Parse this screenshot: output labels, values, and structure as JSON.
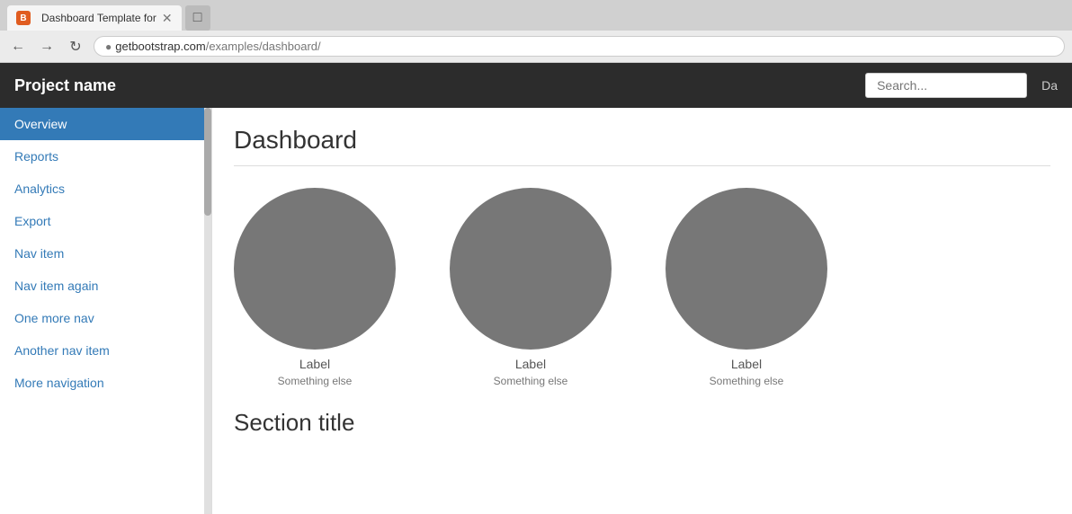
{
  "browser": {
    "tab_title": "Dashboard Template for",
    "tab_icon": "B",
    "address_domain": "getbootstrap.com",
    "address_path": "/examples/dashboard/",
    "new_tab_icon": "+"
  },
  "app": {
    "brand": "Project name",
    "search_placeholder": "Search...",
    "navbar_link": "Da"
  },
  "sidebar": {
    "items": [
      {
        "label": "Overview",
        "active": true
      },
      {
        "label": "Reports",
        "active": false
      },
      {
        "label": "Analytics",
        "active": false
      },
      {
        "label": "Export",
        "active": false
      },
      {
        "label": "Nav item",
        "active": false
      },
      {
        "label": "Nav item again",
        "active": false
      },
      {
        "label": "One more nav",
        "active": false
      },
      {
        "label": "Another nav item",
        "active": false
      },
      {
        "label": "More navigation",
        "active": false
      }
    ]
  },
  "main": {
    "page_title": "Dashboard",
    "section_title": "Section title",
    "charts": [
      {
        "label": "Label",
        "sublabel": "Something else"
      },
      {
        "label": "Label",
        "sublabel": "Something else"
      },
      {
        "label": "Label",
        "sublabel": "Something else"
      }
    ]
  }
}
